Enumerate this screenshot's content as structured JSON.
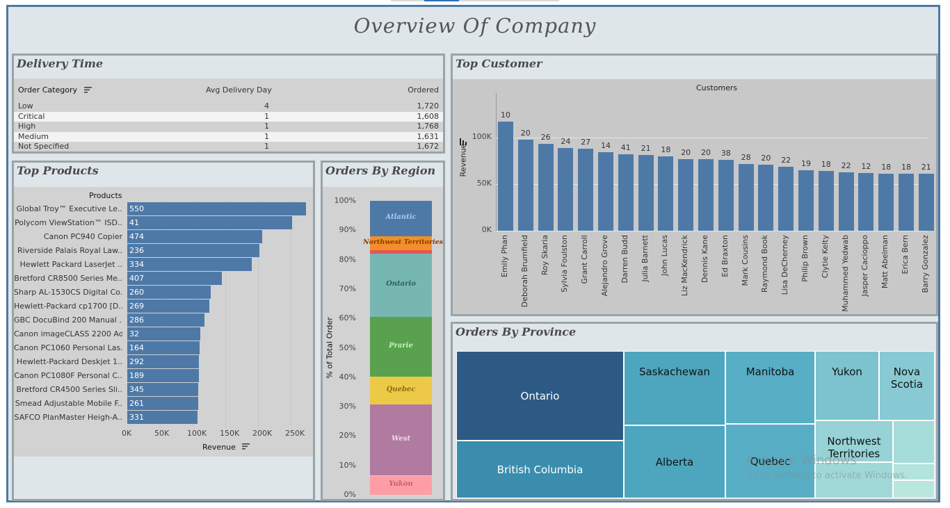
{
  "dashboard": {
    "title": "Overview Of  Company"
  },
  "delivery": {
    "title": "Delivery Time",
    "columns": [
      "Order Category",
      "Avg Delivery Day",
      "Ordered"
    ],
    "rows": [
      {
        "category": "Low",
        "avg": "4",
        "ordered": "1,720"
      },
      {
        "category": "Critical",
        "avg": "1",
        "ordered": "1,608"
      },
      {
        "category": "High",
        "avg": "1",
        "ordered": "1,768"
      },
      {
        "category": "Medium",
        "avg": "1",
        "ordered": "1,631"
      },
      {
        "category": "Not Specified",
        "avg": "1",
        "ordered": "1,672"
      }
    ]
  },
  "top_products": {
    "title": "Top Products",
    "header": "Products",
    "xlabel": "Revenue",
    "ticks": [
      "0K",
      "50K",
      "100K",
      "150K",
      "200K",
      "250K"
    ],
    "items": [
      {
        "name": "Global Troy™ Executive Le..",
        "label": "550",
        "revenue": 273000
      },
      {
        "name": "Polycom ViewStation™ ISD..",
        "label": "41",
        "revenue": 252000
      },
      {
        "name": "Canon PC940 Copier",
        "label": "474",
        "revenue": 206000
      },
      {
        "name": "Riverside Palais Royal Law..",
        "label": "236",
        "revenue": 202000
      },
      {
        "name": "Hewlett Packard LaserJet ..",
        "label": "334",
        "revenue": 190000
      },
      {
        "name": "Bretford CR8500 Series Me..",
        "label": "407",
        "revenue": 145000
      },
      {
        "name": "Sharp AL-1530CS Digital Co..",
        "label": "260",
        "revenue": 128000
      },
      {
        "name": "Hewlett-Packard cp1700 [D..",
        "label": "269",
        "revenue": 126000
      },
      {
        "name": "GBC DocuBind 200 Manual ..",
        "label": "286",
        "revenue": 118000
      },
      {
        "name": "Canon imageCLASS 2200 Ad..",
        "label": "32",
        "revenue": 112000
      },
      {
        "name": "Canon PC1060 Personal Las..",
        "label": "164",
        "revenue": 111000
      },
      {
        "name": "Hewlett-Packard Deskjet 1..",
        "label": "292",
        "revenue": 110000
      },
      {
        "name": "Canon PC1080F Personal C..",
        "label": "189",
        "revenue": 110000
      },
      {
        "name": "Bretford CR4500 Series Sli..",
        "label": "345",
        "revenue": 109000
      },
      {
        "name": "Smead Adjustable Mobile F..",
        "label": "261",
        "revenue": 108000
      },
      {
        "name": "SAFCO PlanMaster Heigh-A..",
        "label": "331",
        "revenue": 107000
      }
    ]
  },
  "orders_region": {
    "title": "Orders By Region",
    "ylabel": "% of Total Order",
    "ticks": [
      "100%",
      "90%",
      "80%",
      "70%",
      "60%",
      "50%",
      "40%",
      "30%",
      "20%",
      "10%",
      "0%"
    ],
    "segments": [
      {
        "name": "Yukon",
        "share": 6.5,
        "color": "#ff9da7",
        "text": "#c0606a"
      },
      {
        "name": "West",
        "share": 24.2,
        "color": "#b07aa1",
        "text": "#f0d8ea"
      },
      {
        "name": "Quebec",
        "share": 9.5,
        "color": "#edc948",
        "text": "#8a6d10"
      },
      {
        "name": "Prarie",
        "share": 20.3,
        "color": "#59a14f",
        "text": "#c9f0c0"
      },
      {
        "name": "Ontario",
        "share": 21.6,
        "color": "#76b7b2",
        "text": "#2f5e5a"
      },
      {
        "name": "",
        "share": 1.2,
        "color": "#e15759",
        "text": "#ffffff"
      },
      {
        "name": "Northwest Territories",
        "share": 4.7,
        "color": "#f28e2b",
        "text": "#8a3c00"
      },
      {
        "name": "Atlantic",
        "share": 12.0,
        "color": "#4e79a7",
        "text": "#a9c8ee"
      }
    ]
  },
  "top_customer": {
    "title": "Top Customer",
    "header": "Customers",
    "ylabel": "Revenue",
    "yticks": [
      "100K",
      "50K",
      "0K"
    ],
    "customers": [
      {
        "name": "Emily Phan",
        "label": "10",
        "revenue": 117000
      },
      {
        "name": "Deborah Brumfield",
        "label": "20",
        "revenue": 98000
      },
      {
        "name": "Roy Skaria",
        "label": "26",
        "revenue": 93000
      },
      {
        "name": "Sylvia Foulston",
        "label": "24",
        "revenue": 89000
      },
      {
        "name": "Grant Carroll",
        "label": "27",
        "revenue": 88000
      },
      {
        "name": "Alejandro Grove",
        "label": "14",
        "revenue": 84000
      },
      {
        "name": "Darren Budd",
        "label": "41",
        "revenue": 82000
      },
      {
        "name": "Julia Barnett",
        "label": "21",
        "revenue": 81000
      },
      {
        "name": "John Lucas",
        "label": "18",
        "revenue": 80000
      },
      {
        "name": "Liz MacKendrick",
        "label": "20",
        "revenue": 77000
      },
      {
        "name": "Dennis Kane",
        "label": "20",
        "revenue": 77000
      },
      {
        "name": "Ed Braxton",
        "label": "38",
        "revenue": 76000
      },
      {
        "name": "Mark Cousins",
        "label": "28",
        "revenue": 72000
      },
      {
        "name": "Raymond Book",
        "label": "20",
        "revenue": 71000
      },
      {
        "name": "Lisa DeCherney",
        "label": "22",
        "revenue": 69000
      },
      {
        "name": "Philip Brown",
        "label": "19",
        "revenue": 65000
      },
      {
        "name": "Clytie Kelty",
        "label": "18",
        "revenue": 64000
      },
      {
        "name": "Muhammed Yedwab",
        "label": "22",
        "revenue": 63000
      },
      {
        "name": "Jasper Cacioppo",
        "label": "12",
        "revenue": 62000
      },
      {
        "name": "Matt Abelman",
        "label": "18",
        "revenue": 61000
      },
      {
        "name": "Erica Bern",
        "label": "18",
        "revenue": 61000
      },
      {
        "name": "Barry Gonzalez",
        "label": "21",
        "revenue": 61000
      }
    ]
  },
  "orders_province": {
    "title": "Orders By Province",
    "tiles": [
      {
        "name": "Ontario",
        "color": "#2d5a85",
        "text": "#ffffff"
      },
      {
        "name": "British Columbia",
        "color": "#3b8dae",
        "text": "#ffffff"
      },
      {
        "name": "Saskachewan",
        "color": "#4ea6be",
        "text": "#111111"
      },
      {
        "name": "Alberta",
        "color": "#4ea6be",
        "text": "#111111"
      },
      {
        "name": "Manitoba",
        "color": "#57aec5",
        "text": "#111111"
      },
      {
        "name": "Quebec",
        "color": "#57aec5",
        "text": "#111111"
      },
      {
        "name": "Yukon",
        "color": "#7cc3cf",
        "text": "#111111"
      },
      {
        "name": "Nova Scotia",
        "color": "#87cad3",
        "text": "#111111"
      },
      {
        "name": "Northwest Territories",
        "color": "#96d2d6",
        "text": "#111111"
      },
      {
        "name": "",
        "color": "#a6dcd8",
        "text": "#111111"
      },
      {
        "name": "",
        "color": "#b2e3dc",
        "text": "#111111"
      },
      {
        "name": "",
        "color": "#b9e7df",
        "text": "#111111"
      },
      {
        "name": "",
        "color": "#a0d8d8",
        "text": "#111111"
      }
    ]
  },
  "watermark": {
    "line1": "Activate Windows",
    "line2": "Go to Settings to activate Windows."
  },
  "colors": {
    "frame": "#4f79a4",
    "bar": "#4e79a7",
    "panel_bg": "#dee6ea",
    "panel_border": "#9aa3a8"
  }
}
